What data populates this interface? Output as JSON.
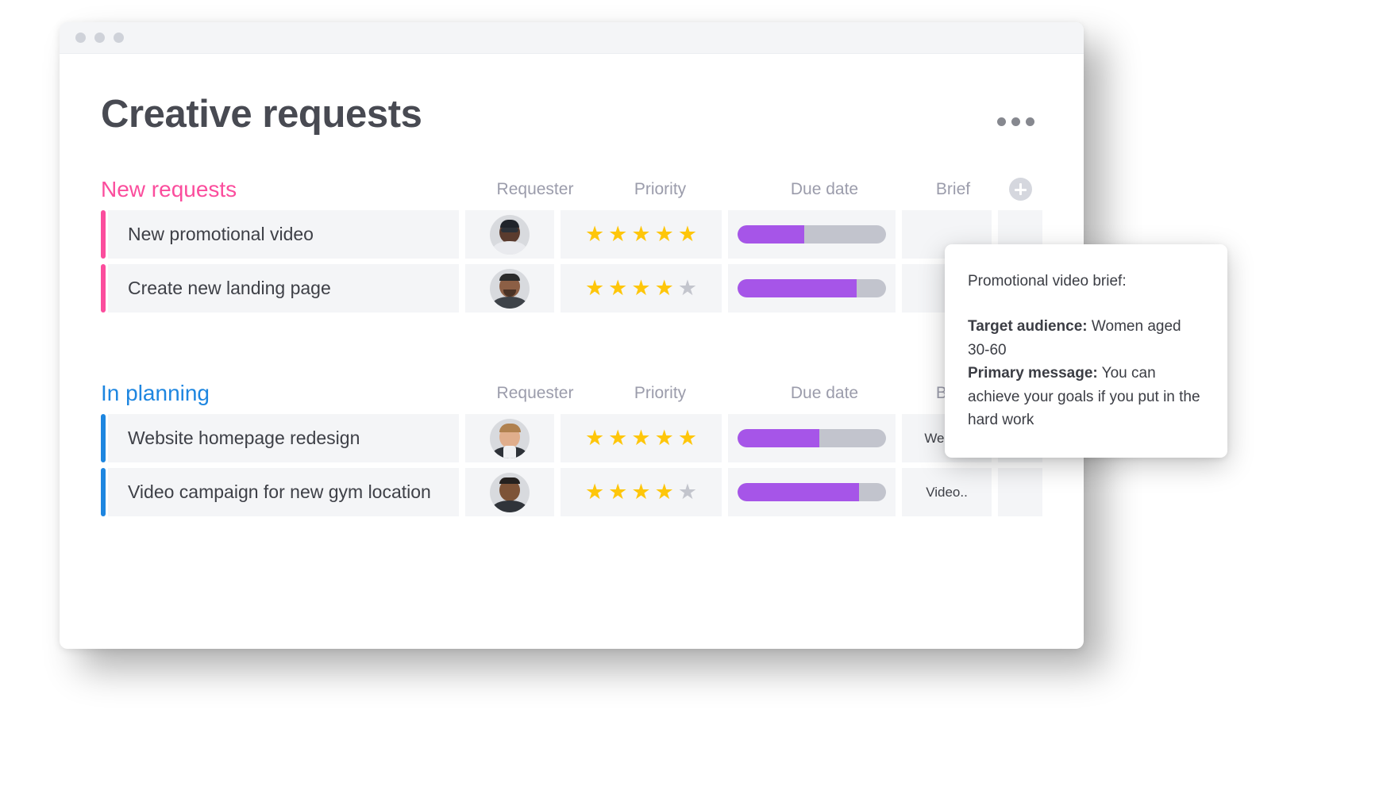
{
  "window": {
    "traffic_lights": [
      "dot",
      "dot",
      "dot"
    ],
    "title": "Creative requests",
    "menu_icon": "kebab-menu-icon"
  },
  "columns": {
    "requester": "Requester",
    "priority": "Priority",
    "due_date": "Due date",
    "brief": "Brief",
    "add": "+"
  },
  "colors": {
    "new_requests_accent": "#fb4d9d",
    "in_planning_accent": "#1e86e0",
    "progress_fill": "#a655e8",
    "progress_track": "#c2c4cd",
    "star_on": "#fec60a",
    "star_off": "#c3c5cd",
    "row_bg": "#f4f5f7",
    "title_color": "#484a52",
    "column_header_color": "#9b9cab"
  },
  "groups": [
    {
      "name": "New requests",
      "accent": "pink",
      "rows": [
        {
          "title": "New promotional video",
          "stars_filled": 5,
          "stars_total": 5,
          "progress_percent": 45,
          "brief": "",
          "avatar": "avatar-woman-glasses"
        },
        {
          "title": "Create new landing page",
          "stars_filled": 4,
          "stars_total": 5,
          "progress_percent": 80,
          "brief": "",
          "avatar": "avatar-man-beard"
        }
      ]
    },
    {
      "name": "In planning",
      "accent": "blue",
      "rows": [
        {
          "title": "Website homepage redesign",
          "stars_filled": 5,
          "stars_total": 5,
          "progress_percent": 55,
          "brief": "Websi..",
          "avatar": "avatar-man-blond"
        },
        {
          "title": "Video campaign for new gym location",
          "stars_filled": 4,
          "stars_total": 5,
          "progress_percent": 82,
          "brief": "Video..",
          "avatar": "avatar-man-short-hair"
        }
      ]
    }
  ],
  "tooltip": {
    "heading": "Promotional video brief:",
    "target_audience_label": "Target audience:",
    "target_audience_value": " Women aged 30-60",
    "primary_message_label": "Primary message:",
    "primary_message_value": " You can achieve your goals if you put in the hard work"
  }
}
